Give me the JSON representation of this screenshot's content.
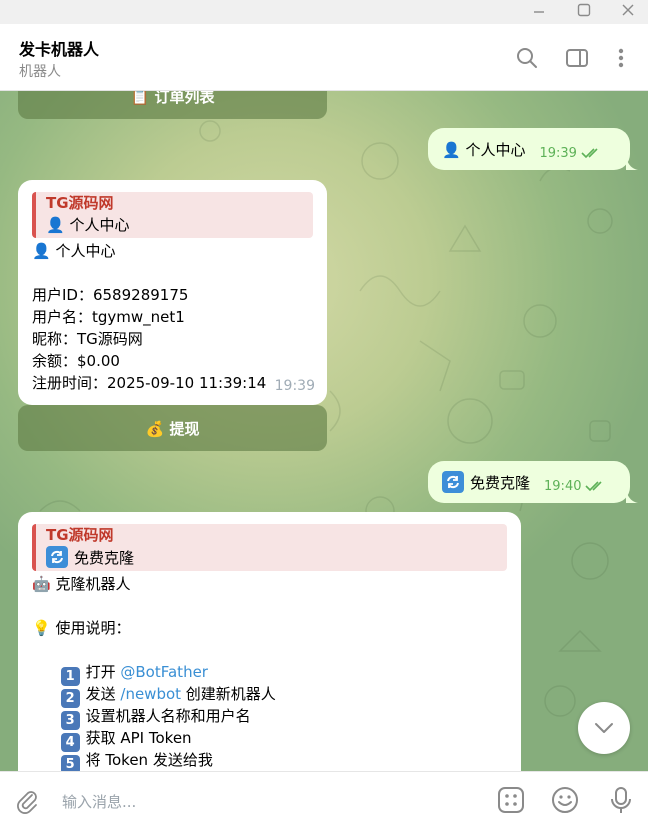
{
  "window": {
    "minimize_icon": "minimize-icon",
    "maximize_icon": "maximize-icon",
    "close_icon": "close-icon"
  },
  "header": {
    "title": "发卡机器人",
    "subtitle": "机器人",
    "icons": [
      "search-icon",
      "sidebar-toggle-icon",
      "more-icon"
    ]
  },
  "messages": {
    "top_button": "📋 订单列表",
    "out1": {
      "text": "👤 个人中心",
      "time": "19:39",
      "status": "read"
    },
    "in1": {
      "quote_title": "TG源码网",
      "quote_text": "👤 个人中心",
      "heading": "👤 个人中心",
      "lines": [
        "用户ID：6589289175",
        "用户名：tgymw_net1",
        "昵称：TG源码网",
        "余额：$0.00",
        "注册时间：2025-09-10 11:39:14"
      ],
      "time": "19:39"
    },
    "withdraw_button": "💰 提现",
    "out2": {
      "text": "免费克隆",
      "time": "19:40",
      "status": "read"
    },
    "in2": {
      "quote_title": "TG源码网",
      "quote_text": "免费克隆",
      "heading": "🤖 克隆机器人",
      "usage_title": "💡 使用说明：",
      "steps": [
        {
          "num": "1",
          "pre": "打开 ",
          "link": "@BotFather",
          "post": ""
        },
        {
          "num": "2",
          "pre": "发送 ",
          "link": "/newbot",
          "post": " 创建新机器人"
        },
        {
          "num": "3",
          "pre": "设置机器人名称和用户名",
          "link": "",
          "post": ""
        },
        {
          "num": "4",
          "pre": "获取 API Token",
          "link": "",
          "post": ""
        },
        {
          "num": "5",
          "pre": "将 Token 发送给我",
          "link": "",
          "post": ""
        }
      ]
    }
  },
  "composer": {
    "placeholder": "输入消息...",
    "icons": [
      "attach-icon",
      "bot-menu-icon",
      "emoji-icon",
      "microphone-icon"
    ]
  },
  "colors": {
    "outgoing_bubble": "#eeffde",
    "incoming_bubble": "#ffffff",
    "quote_bar": "#d9534f",
    "quote_title": "#c0392b",
    "link": "#3a8fd4",
    "time_out": "#5db157",
    "inline_button": "#607c46"
  }
}
